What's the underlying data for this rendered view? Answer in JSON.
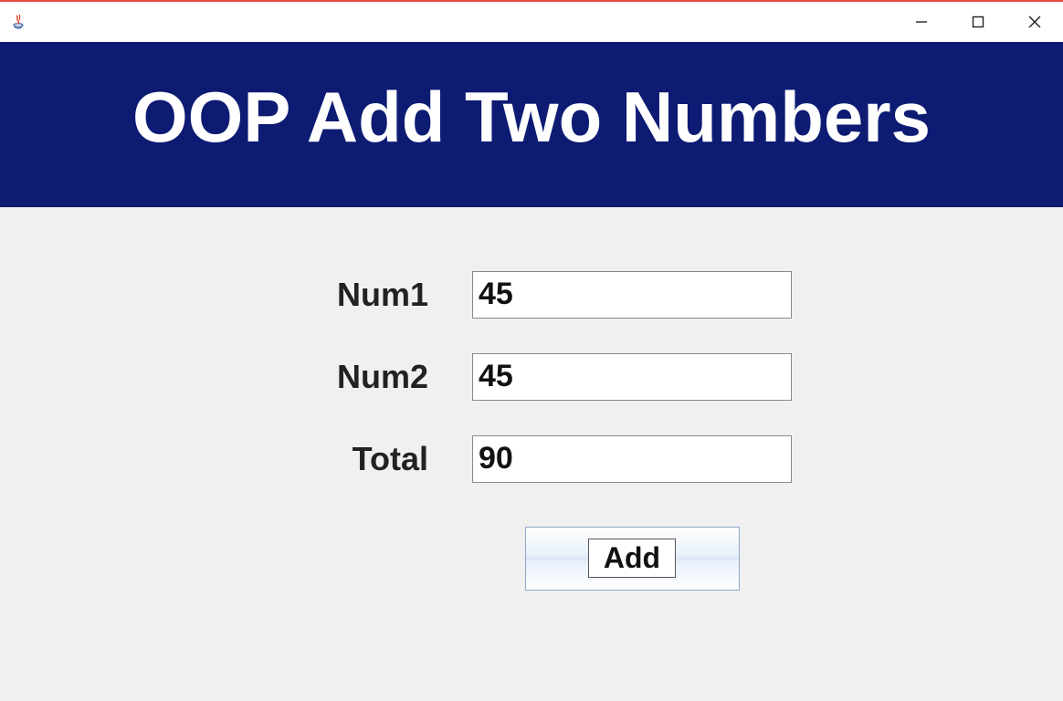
{
  "window": {
    "title": ""
  },
  "banner": {
    "title": "OOP Add Two Numbers"
  },
  "form": {
    "num1": {
      "label": "Num1",
      "value": "45"
    },
    "num2": {
      "label": "Num2",
      "value": "45"
    },
    "total": {
      "label": "Total",
      "value": "90"
    },
    "add_button": {
      "label": "Add"
    }
  },
  "colors": {
    "banner_bg": "#0d1b73",
    "content_bg": "#f0f0f0"
  }
}
